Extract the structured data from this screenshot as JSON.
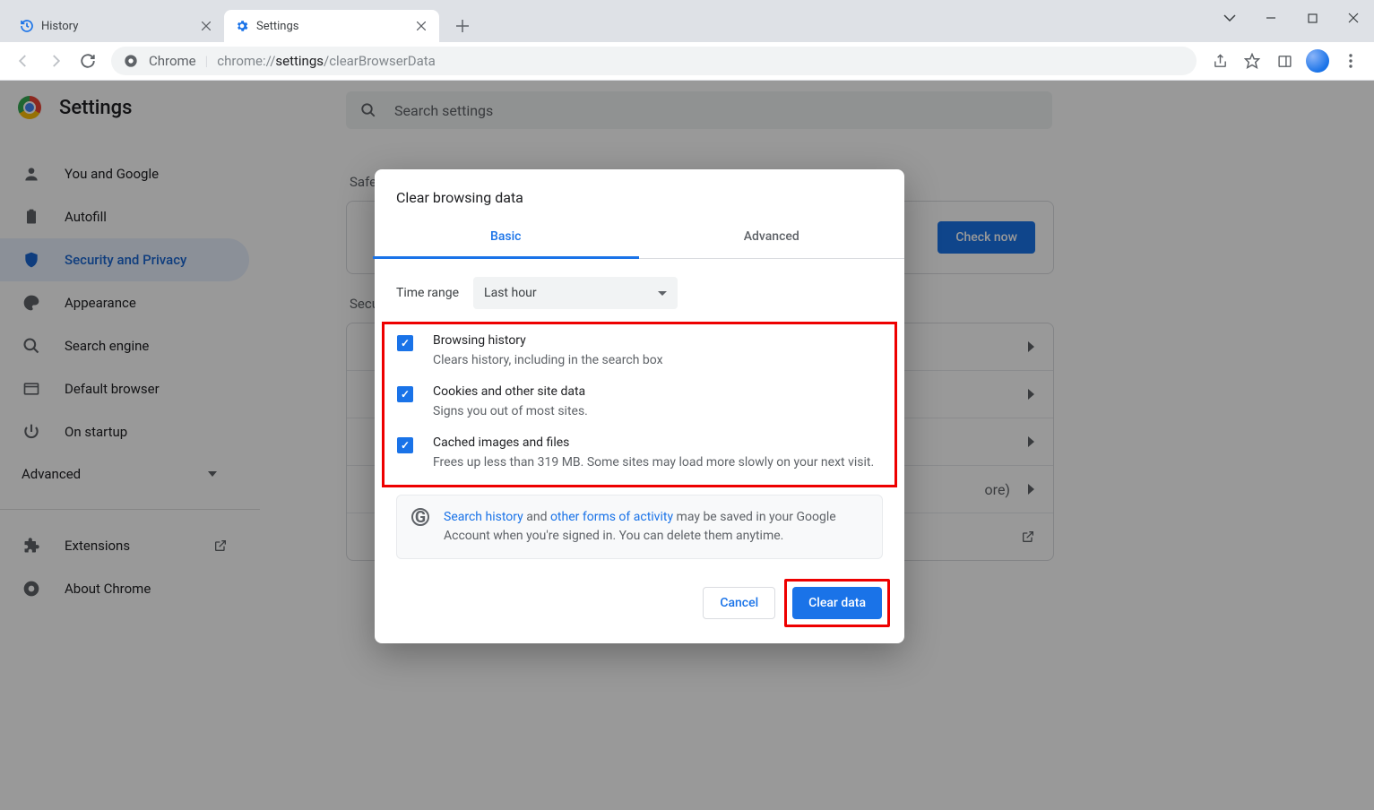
{
  "browser": {
    "tabs": [
      {
        "title": "History",
        "active": false
      },
      {
        "title": "Settings",
        "active": true
      }
    ],
    "omnibox": {
      "label": "Chrome",
      "prefix": "chrome://",
      "strong": "settings",
      "suffix": "/clearBrowserData"
    }
  },
  "settings": {
    "title": "Settings",
    "search_placeholder": "Search settings",
    "sidebar": [
      {
        "label": "You and Google",
        "icon": "person"
      },
      {
        "label": "Autofill",
        "icon": "clipboard"
      },
      {
        "label": "Security and Privacy",
        "icon": "shield",
        "active": true
      },
      {
        "label": "Appearance",
        "icon": "palette"
      },
      {
        "label": "Search engine",
        "icon": "search"
      },
      {
        "label": "Default browser",
        "icon": "browser"
      },
      {
        "label": "On startup",
        "icon": "power"
      }
    ],
    "advanced_label": "Advanced",
    "footer": [
      {
        "label": "Extensions",
        "ext": true
      },
      {
        "label": "About Chrome",
        "ext": false
      }
    ]
  },
  "content": {
    "section1": "Safe",
    "check_now": "Check now",
    "section2": "Secu",
    "row_more": "ore)"
  },
  "dialog": {
    "title": "Clear browsing data",
    "tabs": {
      "basic": "Basic",
      "advanced": "Advanced"
    },
    "time_label": "Time range",
    "time_value": "Last hour",
    "items": [
      {
        "title": "Browsing history",
        "desc": "Clears history, including in the search box"
      },
      {
        "title": "Cookies and other site data",
        "desc": "Signs you out of most sites."
      },
      {
        "title": "Cached images and files",
        "desc": "Frees up less than 319 MB. Some sites may load more slowly on your next visit."
      }
    ],
    "info": {
      "link1": "Search history",
      "mid": " and ",
      "link2": "other forms of activity",
      "rest": " may be saved in your Google Account when you're signed in. You can delete them anytime."
    },
    "cancel": "Cancel",
    "clear": "Clear data"
  }
}
